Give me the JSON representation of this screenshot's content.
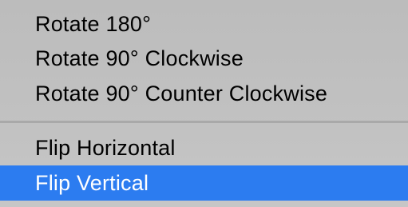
{
  "menu": {
    "items": [
      {
        "label": "Rotate 180°"
      },
      {
        "label": "Rotate 90° Clockwise"
      },
      {
        "label": "Rotate 90° Counter Clockwise"
      },
      {
        "label": "Flip Horizontal"
      },
      {
        "label": "Flip Vertical",
        "highlighted": true
      }
    ],
    "highlight_color": "#2c7cf0",
    "background_color": "#c0c0c0",
    "separator_color": "#a9a9a9"
  }
}
